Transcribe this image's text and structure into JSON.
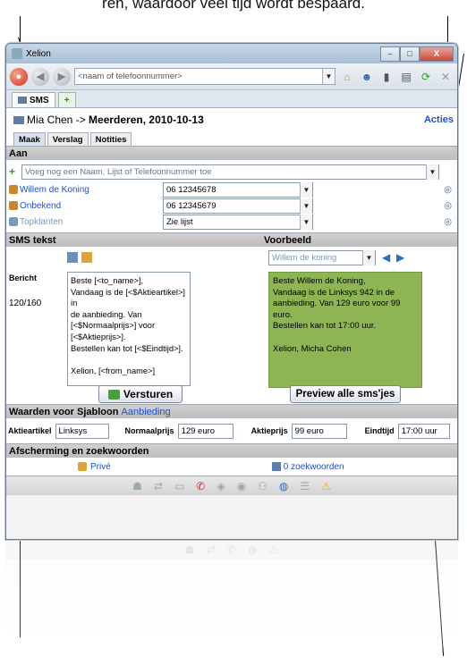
{
  "caption": "ren, waardoor veel tijd wordt bespaard.",
  "window": {
    "title": "Xelion",
    "buttons": [
      "–",
      "□",
      "X"
    ]
  },
  "toolbar": {
    "search_placeholder": "<naam of telefoonnummer>"
  },
  "tabs": [
    {
      "label": "SMS"
    },
    {
      "label": "+"
    }
  ],
  "heading": {
    "prefix": "Mia Chen -> ",
    "title_bold": "Meerderen, 2010-10-13",
    "acties": "Acties"
  },
  "subtabs": [
    "Maak",
    "Verslag",
    "Notities"
  ],
  "aan": {
    "section": "Aan",
    "placeholder": "Voeg nog een Naam, Lijst of Telefoonnummer toe",
    "recipients": [
      {
        "name": "Willem de Koning",
        "number": "06 12345678"
      },
      {
        "name": "Onbekend",
        "number": "06 12345679"
      },
      {
        "name": "Topklanten",
        "number": "Zie lijst"
      }
    ]
  },
  "sms": {
    "section": "SMS tekst",
    "bericht_label": "Bericht",
    "counter": "120/160",
    "text_lines": [
      "Beste [<to_name>],",
      "Vandaag is de [<$Aktieartikel>] in",
      "de aanbieding. Van",
      "[<$Normaalprijs>] voor",
      "[<$Aktieprijs>].",
      "Bestellen kan tot [<$Eindtijd>].",
      "",
      "Xelion, [<from_name>]"
    ],
    "send_button": "Versturen"
  },
  "preview": {
    "section": "Voorbeeld",
    "select_value": "Willem de koning",
    "text_lines": [
      "Beste Willem de Koning,",
      "Vandaag is de Linksys 942 in de",
      "aanbieding. Van 129 euro voor 99",
      "euro.",
      "Bestellen kan tot 17:00 uur.",
      "",
      "Xelion, Micha Cohen"
    ],
    "preview_button": "Preview alle sms'jes"
  },
  "waarden": {
    "section_prefix": "Waarden voor Sjabloon ",
    "section_link": "Aanbieding",
    "fields": [
      {
        "label": "Aktieartikel",
        "value": "Linksys"
      },
      {
        "label": "Normaalprijs",
        "value": "129 euro"
      },
      {
        "label": "Aktieprijs",
        "value": "99 euro"
      },
      {
        "label": "Eindtijd",
        "value": "17:00 uur"
      }
    ]
  },
  "afscherming": {
    "section": "Afscherming en zoekwoorden",
    "prive": "Privé",
    "zoekwoorden": "0 zoekwoorden"
  },
  "colors": {
    "preview_green": "#8db553",
    "link_blue": "#1f4fd1",
    "section_grey": "#c4c4c4"
  }
}
